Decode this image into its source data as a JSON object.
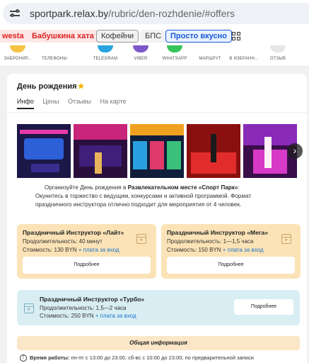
{
  "browser": {
    "url_host": "sportpark.relax.by",
    "url_path": "/rubric/den-rozhdenie/#offers"
  },
  "chips": [
    "westa",
    "Бабушкина хата",
    "Кофейни",
    "БПС",
    "Просто вкусно"
  ],
  "contacts": [
    {
      "label": "ЗАБРОНИР...",
      "color": "#f5c242"
    },
    {
      "label": "ТЕЛЕФОНЫ",
      "color": "#ffffff"
    },
    {
      "label": "TELEGRAM",
      "color": "#2aa3e0"
    },
    {
      "label": "VIBER",
      "color": "#7d58c9"
    },
    {
      "label": "WHATSAPP",
      "color": "#35c35a"
    },
    {
      "label": "МАРШРУТ",
      "color": "#ffffff"
    },
    {
      "label": "В ИЗБРАНН...",
      "color": "#ffffff"
    },
    {
      "label": "ОТЗЫВ",
      "color": "#e6e6e6"
    }
  ],
  "section": {
    "title": "День рождения",
    "tabs": [
      "Инфо",
      "Цены",
      "Отзывы",
      "На карте"
    ],
    "active_tab": "Инфо"
  },
  "description": {
    "line1_prefix": "Организуйте День рождения в ",
    "line1_place": "Развлекательном месте «Спорт Парк»",
    "line1_suffix": ":",
    "line2": "Окунитесь в торжество с ведущим, конкурсами и активной программой. Формат",
    "line3": "праздничного инструктора отлично подходит для мероприятия от 4 человек."
  },
  "offers": [
    {
      "name": "Праздничный Инструктор «Лайт»",
      "duration": "Продолжительность: 40 минут",
      "price": "Стоимость: 130 BYN",
      "plus": "+ плата за вход",
      "button": "Подробнее"
    },
    {
      "name": "Праздничный Инструктор «Мега»",
      "duration": "Продолжительность: 1—1,5 часа",
      "price": "Стоимость: 150 BYN",
      "plus": "+ плата за вход",
      "button": "Подробнее"
    },
    {
      "name": "Праздничный Инструктор «Турбо»",
      "duration": "Продолжительность: 1,5—2 часа",
      "price": "Стоимость: 250 BYN",
      "plus": "+ плата за вход",
      "button": "Подробнее"
    }
  ],
  "general_info": {
    "heading": "Общая информация",
    "row_label": "Время работы:",
    "row_text": "пн-пт с 13:00 до 23:00, сб-вс с 10:00 до 23:00, по предварительной записи"
  },
  "colors": {
    "offer_yellow": "#fbe3b7",
    "offer_blue": "#d9eef3",
    "link_blue": "#1a73c9",
    "chip_active": "#1a5bd6"
  }
}
